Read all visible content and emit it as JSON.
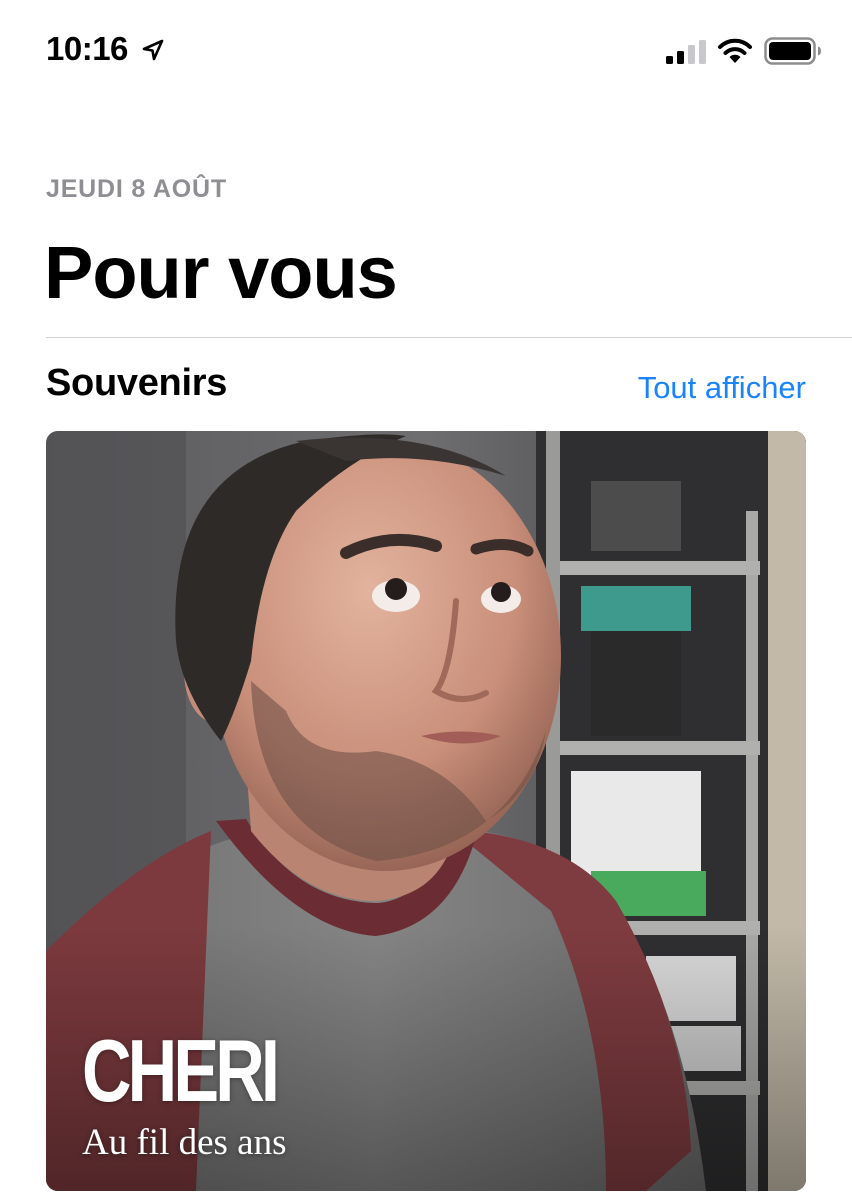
{
  "status_bar": {
    "time": "10:16",
    "icons": [
      "location-arrow-icon",
      "cellular-signal-icon",
      "wifi-icon",
      "battery-icon"
    ]
  },
  "header": {
    "date": "JEUDI 8 AOÛT",
    "title": "Pour vous"
  },
  "memories_section": {
    "title": "Souvenirs",
    "see_all_label": "Tout afficher",
    "card": {
      "title": "CHERI",
      "subtitle": "Au fil des ans"
    }
  },
  "colors": {
    "accent": "#1a84ff",
    "secondary_text": "#8e8e93",
    "divider": "#d1d1d6"
  }
}
